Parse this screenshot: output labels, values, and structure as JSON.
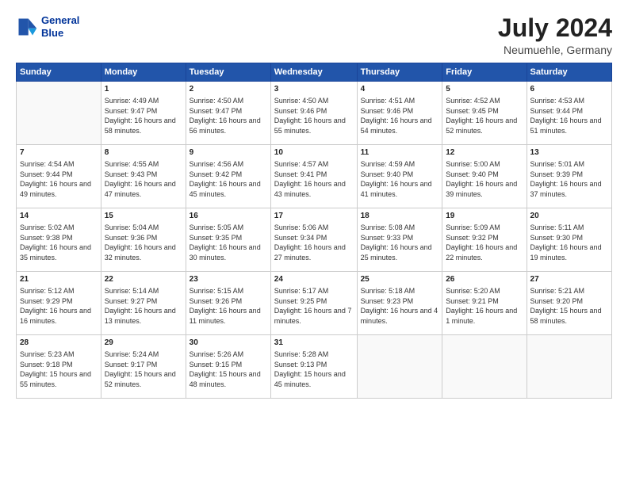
{
  "logo": {
    "line1": "General",
    "line2": "Blue"
  },
  "title": "July 2024",
  "location": "Neumuehle, Germany",
  "headers": [
    "Sunday",
    "Monday",
    "Tuesday",
    "Wednesday",
    "Thursday",
    "Friday",
    "Saturday"
  ],
  "weeks": [
    [
      {
        "day": "",
        "sunrise": "",
        "sunset": "",
        "daylight": ""
      },
      {
        "day": "1",
        "sunrise": "Sunrise: 4:49 AM",
        "sunset": "Sunset: 9:47 PM",
        "daylight": "Daylight: 16 hours and 58 minutes."
      },
      {
        "day": "2",
        "sunrise": "Sunrise: 4:50 AM",
        "sunset": "Sunset: 9:47 PM",
        "daylight": "Daylight: 16 hours and 56 minutes."
      },
      {
        "day": "3",
        "sunrise": "Sunrise: 4:50 AM",
        "sunset": "Sunset: 9:46 PM",
        "daylight": "Daylight: 16 hours and 55 minutes."
      },
      {
        "day": "4",
        "sunrise": "Sunrise: 4:51 AM",
        "sunset": "Sunset: 9:46 PM",
        "daylight": "Daylight: 16 hours and 54 minutes."
      },
      {
        "day": "5",
        "sunrise": "Sunrise: 4:52 AM",
        "sunset": "Sunset: 9:45 PM",
        "daylight": "Daylight: 16 hours and 52 minutes."
      },
      {
        "day": "6",
        "sunrise": "Sunrise: 4:53 AM",
        "sunset": "Sunset: 9:44 PM",
        "daylight": "Daylight: 16 hours and 51 minutes."
      }
    ],
    [
      {
        "day": "7",
        "sunrise": "Sunrise: 4:54 AM",
        "sunset": "Sunset: 9:44 PM",
        "daylight": "Daylight: 16 hours and 49 minutes."
      },
      {
        "day": "8",
        "sunrise": "Sunrise: 4:55 AM",
        "sunset": "Sunset: 9:43 PM",
        "daylight": "Daylight: 16 hours and 47 minutes."
      },
      {
        "day": "9",
        "sunrise": "Sunrise: 4:56 AM",
        "sunset": "Sunset: 9:42 PM",
        "daylight": "Daylight: 16 hours and 45 minutes."
      },
      {
        "day": "10",
        "sunrise": "Sunrise: 4:57 AM",
        "sunset": "Sunset: 9:41 PM",
        "daylight": "Daylight: 16 hours and 43 minutes."
      },
      {
        "day": "11",
        "sunrise": "Sunrise: 4:59 AM",
        "sunset": "Sunset: 9:40 PM",
        "daylight": "Daylight: 16 hours and 41 minutes."
      },
      {
        "day": "12",
        "sunrise": "Sunrise: 5:00 AM",
        "sunset": "Sunset: 9:40 PM",
        "daylight": "Daylight: 16 hours and 39 minutes."
      },
      {
        "day": "13",
        "sunrise": "Sunrise: 5:01 AM",
        "sunset": "Sunset: 9:39 PM",
        "daylight": "Daylight: 16 hours and 37 minutes."
      }
    ],
    [
      {
        "day": "14",
        "sunrise": "Sunrise: 5:02 AM",
        "sunset": "Sunset: 9:38 PM",
        "daylight": "Daylight: 16 hours and 35 minutes."
      },
      {
        "day": "15",
        "sunrise": "Sunrise: 5:04 AM",
        "sunset": "Sunset: 9:36 PM",
        "daylight": "Daylight: 16 hours and 32 minutes."
      },
      {
        "day": "16",
        "sunrise": "Sunrise: 5:05 AM",
        "sunset": "Sunset: 9:35 PM",
        "daylight": "Daylight: 16 hours and 30 minutes."
      },
      {
        "day": "17",
        "sunrise": "Sunrise: 5:06 AM",
        "sunset": "Sunset: 9:34 PM",
        "daylight": "Daylight: 16 hours and 27 minutes."
      },
      {
        "day": "18",
        "sunrise": "Sunrise: 5:08 AM",
        "sunset": "Sunset: 9:33 PM",
        "daylight": "Daylight: 16 hours and 25 minutes."
      },
      {
        "day": "19",
        "sunrise": "Sunrise: 5:09 AM",
        "sunset": "Sunset: 9:32 PM",
        "daylight": "Daylight: 16 hours and 22 minutes."
      },
      {
        "day": "20",
        "sunrise": "Sunrise: 5:11 AM",
        "sunset": "Sunset: 9:30 PM",
        "daylight": "Daylight: 16 hours and 19 minutes."
      }
    ],
    [
      {
        "day": "21",
        "sunrise": "Sunrise: 5:12 AM",
        "sunset": "Sunset: 9:29 PM",
        "daylight": "Daylight: 16 hours and 16 minutes."
      },
      {
        "day": "22",
        "sunrise": "Sunrise: 5:14 AM",
        "sunset": "Sunset: 9:27 PM",
        "daylight": "Daylight: 16 hours and 13 minutes."
      },
      {
        "day": "23",
        "sunrise": "Sunrise: 5:15 AM",
        "sunset": "Sunset: 9:26 PM",
        "daylight": "Daylight: 16 hours and 11 minutes."
      },
      {
        "day": "24",
        "sunrise": "Sunrise: 5:17 AM",
        "sunset": "Sunset: 9:25 PM",
        "daylight": "Daylight: 16 hours and 7 minutes."
      },
      {
        "day": "25",
        "sunrise": "Sunrise: 5:18 AM",
        "sunset": "Sunset: 9:23 PM",
        "daylight": "Daylight: 16 hours and 4 minutes."
      },
      {
        "day": "26",
        "sunrise": "Sunrise: 5:20 AM",
        "sunset": "Sunset: 9:21 PM",
        "daylight": "Daylight: 16 hours and 1 minute."
      },
      {
        "day": "27",
        "sunrise": "Sunrise: 5:21 AM",
        "sunset": "Sunset: 9:20 PM",
        "daylight": "Daylight: 15 hours and 58 minutes."
      }
    ],
    [
      {
        "day": "28",
        "sunrise": "Sunrise: 5:23 AM",
        "sunset": "Sunset: 9:18 PM",
        "daylight": "Daylight: 15 hours and 55 minutes."
      },
      {
        "day": "29",
        "sunrise": "Sunrise: 5:24 AM",
        "sunset": "Sunset: 9:17 PM",
        "daylight": "Daylight: 15 hours and 52 minutes."
      },
      {
        "day": "30",
        "sunrise": "Sunrise: 5:26 AM",
        "sunset": "Sunset: 9:15 PM",
        "daylight": "Daylight: 15 hours and 48 minutes."
      },
      {
        "day": "31",
        "sunrise": "Sunrise: 5:28 AM",
        "sunset": "Sunset: 9:13 PM",
        "daylight": "Daylight: 15 hours and 45 minutes."
      },
      {
        "day": "",
        "sunrise": "",
        "sunset": "",
        "daylight": ""
      },
      {
        "day": "",
        "sunrise": "",
        "sunset": "",
        "daylight": ""
      },
      {
        "day": "",
        "sunrise": "",
        "sunset": "",
        "daylight": ""
      }
    ]
  ]
}
